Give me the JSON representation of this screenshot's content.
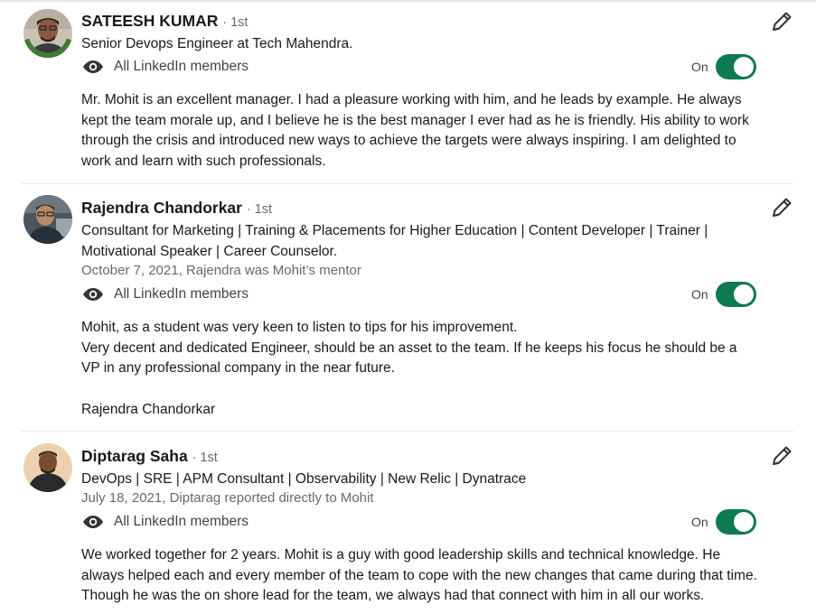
{
  "colors": {
    "toggle_on": "#0f7a51",
    "text_primary": "#1f1f1f",
    "text_secondary": "#666666",
    "divider": "#e6e6e6"
  },
  "recommendations": [
    {
      "name": "SATEESH KUMAR",
      "degree": "· 1st",
      "headline": "Senior Devops Engineer at Tech Mahendra.",
      "relationship": "",
      "visibility": "All LinkedIn members",
      "visibility_icon": "eye-icon",
      "toggle_label": "On",
      "toggle_on": true,
      "edit_icon": "pencil-icon",
      "avatar_badge": "#OPENTOWORK",
      "text": [
        "Mr. Mohit  is an excellent manager. I had a pleasure working with him, and he leads by example. He always kept the team morale up, and I believe he is the best manager I ever had as he is friendly. His ability to work through the crisis and introduced new ways to achieve the targets were always inspiring. I am delighted to work and learn with such professionals."
      ]
    },
    {
      "name": "Rajendra Chandorkar",
      "degree": "· 1st",
      "headline": "Consultant for Marketing | Training & Placements for Higher Education | Content Developer | Trainer | Motivational Speaker | Career Counselor.",
      "relationship": "October 7, 2021, Rajendra was Mohit’s mentor",
      "visibility": "All LinkedIn members",
      "visibility_icon": "eye-icon",
      "toggle_label": "On",
      "toggle_on": true,
      "edit_icon": "pencil-icon",
      "text": [
        "Mohit, as a student was very keen to listen to tips for his improvement.",
        "Very decent and dedicated Engineer, should be an asset to the team. If he keeps his focus he should be a VP in any professional company in the near future.",
        "",
        "Rajendra Chandorkar"
      ]
    },
    {
      "name": "Diptarag Saha",
      "degree": "· 1st",
      "headline": "DevOps | SRE | APM Consultant | Observability | New Relic | Dynatrace",
      "relationship": "July 18, 2021, Diptarag reported directly to Mohit",
      "visibility": "All LinkedIn members",
      "visibility_icon": "eye-icon",
      "toggle_label": "On",
      "toggle_on": true,
      "edit_icon": "pencil-icon",
      "text": [
        "We worked together for 2 years. Mohit is a guy with good leadership skills and technical knowledge. He always helped each and every member of the team to cope with the new changes that came during that time. Though he was the on shore lead for the team, we always had that connect with him in all our works."
      ]
    }
  ]
}
